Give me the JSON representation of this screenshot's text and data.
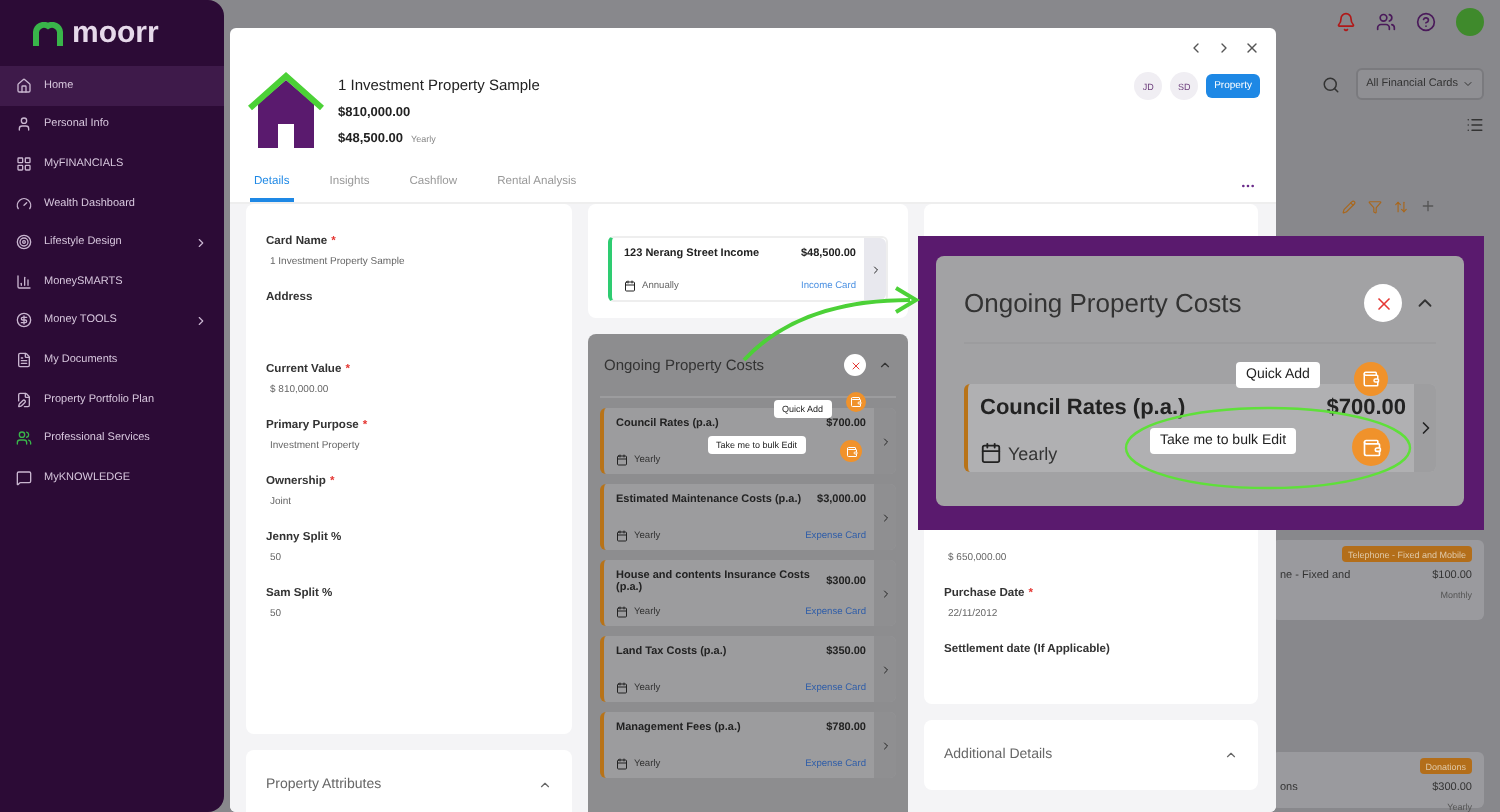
{
  "sidebar": {
    "logo": "moorr",
    "items": [
      {
        "label": "Home",
        "selected": true,
        "expandable": false
      },
      {
        "label": "Personal Info",
        "selected": false,
        "expandable": false
      },
      {
        "label": "MyFINANCIALS",
        "selected": false,
        "expandable": false
      },
      {
        "label": "Wealth Dashboard",
        "selected": false,
        "expandable": false
      },
      {
        "label": "Lifestyle Design",
        "selected": false,
        "expandable": true
      },
      {
        "label": "MoneySMARTS",
        "selected": false,
        "expandable": false
      },
      {
        "label": "Money TOOLS",
        "selected": false,
        "expandable": true
      },
      {
        "label": "My Documents",
        "selected": false,
        "expandable": false
      },
      {
        "label": "Property Portfolio Plan",
        "selected": false,
        "expandable": false
      },
      {
        "label": "Professional Services",
        "selected": false,
        "expandable": false
      },
      {
        "label": "MyKNOWLEDGE",
        "selected": false,
        "expandable": false
      }
    ]
  },
  "background": {
    "filter": "All Financial Cards",
    "cards": [
      {
        "badge": "Telephone - Fixed and Mobile",
        "name": "ne - Fixed and",
        "amount": "$100.00",
        "frequency": "Monthly"
      },
      {
        "badge": "Donations",
        "name": "ons",
        "amount": "$300.00",
        "frequency": "Yearly"
      }
    ]
  },
  "modal": {
    "title": "1 Investment Property Sample",
    "value": "$810,000.00",
    "income": "$48,500.00",
    "income_frequency": "Yearly",
    "owners": [
      "JD",
      "SD"
    ],
    "type_tag": "Property",
    "tabs": [
      {
        "label": "Details",
        "selected": true
      },
      {
        "label": "Insights",
        "selected": false
      },
      {
        "label": "Cashflow",
        "selected": false
      },
      {
        "label": "Rental Analysis",
        "selected": false
      }
    ],
    "details": [
      {
        "label": "Card Name",
        "mark": "*",
        "value": "1 Investment Property Sample"
      },
      {
        "label": "Address"
      },
      {
        "label": "Current Value",
        "mark": "*",
        "value": "$ 810,000.00"
      },
      {
        "label": "Primary Purpose",
        "mark": "*",
        "value": "Investment Property"
      },
      {
        "label": "Ownership",
        "mark": "*",
        "value": "Joint"
      },
      {
        "label": "Jenny Split %",
        "value": "50"
      },
      {
        "label": "Sam Split %",
        "value": "50"
      }
    ],
    "property_attributes": "Property Attributes",
    "income_cards": [
      {
        "name": "123 Nerang Street Income",
        "amount": "$48,500.00",
        "frequency": "Annually",
        "type": "Income Card"
      }
    ],
    "costs": {
      "title": "Ongoing Property Costs",
      "quick_add": "Quick Add",
      "bulk_edit": "Take me to bulk Edit",
      "cards": [
        {
          "name": "Council Rates (p.a.)",
          "amount": "$700.00",
          "frequency": "Yearly"
        },
        {
          "name": "Estimated Maintenance Costs (p.a.)",
          "amount": "$3,000.00",
          "frequency": "Yearly",
          "type": "Expense Card"
        },
        {
          "name": "House and contents Insurance Costs (p.a.)",
          "amount": "$300.00",
          "frequency": "Yearly",
          "type": "Expense Card"
        },
        {
          "name": "Land Tax Costs (p.a.)",
          "amount": "$350.00",
          "frequency": "Yearly",
          "type": "Expense Card"
        },
        {
          "name": "Management Fees (p.a.)",
          "amount": "$780.00",
          "frequency": "Yearly",
          "type": "Expense Card"
        }
      ]
    },
    "purchase": [
      {
        "value": "$ 650,000.00"
      },
      {
        "label": "Purchase Date",
        "mark": "*",
        "value": "22/11/2012"
      },
      {
        "label": "Settlement date (If Applicable)"
      }
    ],
    "additional_details": "Additional Details"
  },
  "callout": {
    "title": "Ongoing Property Costs",
    "quick_add": "Quick Add",
    "bulk_edit": "Take me to bulk Edit",
    "card": {
      "name": "Council Rates (p.a.)",
      "amount": "$700.00",
      "frequency": "Yearly"
    }
  }
}
